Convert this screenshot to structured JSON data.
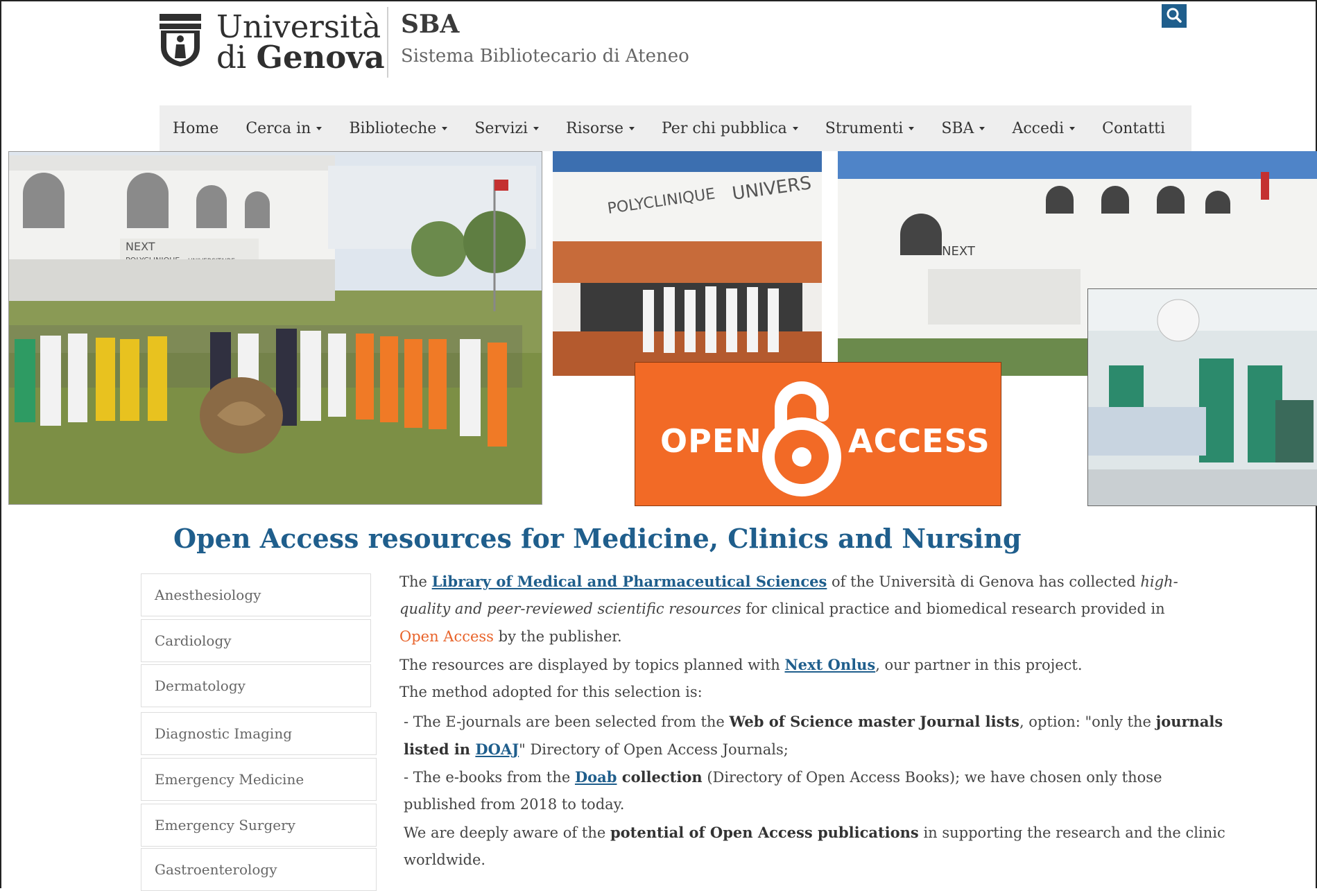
{
  "header": {
    "university_line1": "Università",
    "university_line2_prefix": "di",
    "university_line2_bold": "Genova",
    "site_title": "SBA",
    "site_subtitle": "Sistema Bibliotecario di Ateneo"
  },
  "nav": {
    "items": [
      {
        "label": "Home",
        "dropdown": false
      },
      {
        "label": "Cerca in",
        "dropdown": true
      },
      {
        "label": "Biblioteche",
        "dropdown": true
      },
      {
        "label": "Servizi",
        "dropdown": true
      },
      {
        "label": "Risorse",
        "dropdown": true
      },
      {
        "label": "Per chi pubblica",
        "dropdown": true
      },
      {
        "label": "Strumenti",
        "dropdown": true
      },
      {
        "label": "SBA",
        "dropdown": true
      },
      {
        "label": "Accedi",
        "dropdown": true
      },
      {
        "label": "Contatti",
        "dropdown": false
      }
    ]
  },
  "banner": {
    "oa_open": "OPEN",
    "oa_access": "ACCESS",
    "sign_next": "NEXT",
    "sign_polyclinique": "POLYCLINIQUE",
    "sign_universitaire": "UNIVERSITAIRE",
    "sign_univers": "UNIVERS"
  },
  "page": {
    "title": "Open Access resources for Medicine, Clinics and Nursing"
  },
  "sidebar": {
    "items": [
      "Anesthesiology",
      "Cardiology",
      "Dermatology",
      "Diagnostic Imaging",
      "Emergency Medicine",
      "Emergency Surgery",
      "Gastroenterology"
    ]
  },
  "content": {
    "p1_pre": "The ",
    "p1_link": "Library of Medical and Pharmaceutical Sciences",
    "p1_mid": " of the Università di Genova has collected ",
    "p1_em": "high-",
    "p2_em": "quality and peer-reviewed scientific resources",
    "p2_post": " for clinical practice and biomedical research provided in",
    "p3_oa": "Open Access",
    "p3_post": " by the publisher.",
    "p4_pre": "The resources are displayed by topics planned with ",
    "p4_link": "Next Onlus",
    "p4_post": ", our partner in this project.",
    "p5": "The method adopted for this selection is:",
    "p6_pre": "- The E-journals are been selected from the ",
    "p6_bold": "Web of Science master Journal lists",
    "p6_mid": ", option: \"only the ",
    "p6_bold2": "journals",
    "p7_bold": "listed in ",
    "p7_link": "DOAJ",
    "p7_post": "\" Directory of Open Access Journals;",
    "p8_pre": "- The e-books from the ",
    "p8_link": "Doab",
    "p8_bold": " collection",
    "p8_post": " (Directory of Open Access Books); we have chosen only those",
    "p9": "published from 2018 to today.",
    "p10_pre": "We are deeply aware of the ",
    "p10_bold": "potential of Open Access publications",
    "p10_post": " in supporting the research and the clinic",
    "p11": "worldwide."
  },
  "colors": {
    "brand_blue": "#1f5e8c",
    "oa_orange": "#f26a26",
    "nav_bg": "#eeeeee"
  }
}
